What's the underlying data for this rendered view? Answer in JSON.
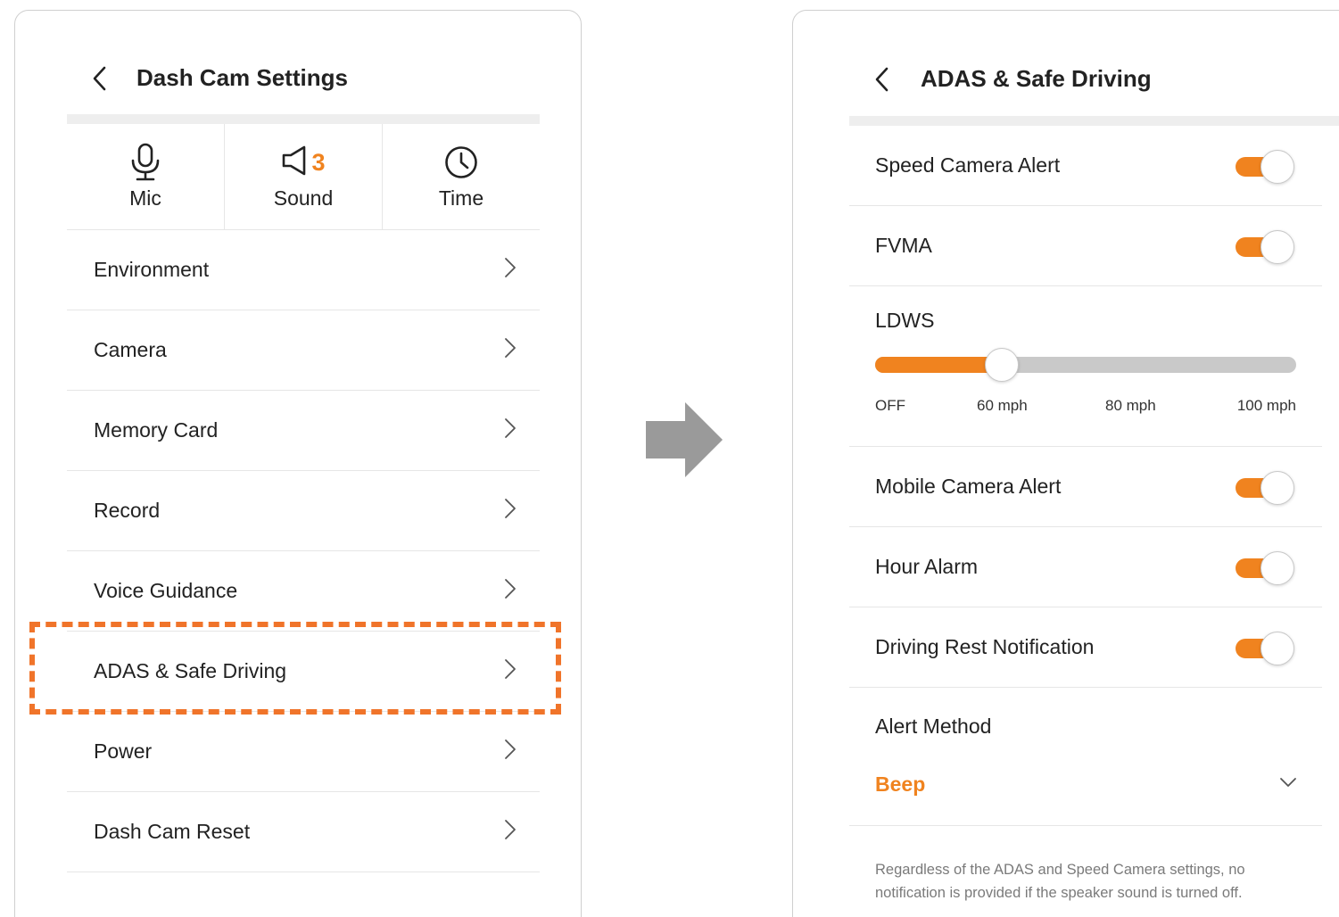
{
  "colors": {
    "accent": "#f0831f",
    "highlight": "#f0742a",
    "divider": "#e6e6e6",
    "arrow": "#9a9a9a"
  },
  "left": {
    "title": "Dash Cam Settings",
    "tiles": [
      {
        "label": "Mic",
        "icon": "microphone-icon"
      },
      {
        "label": "Sound",
        "icon": "speaker-icon",
        "level": "3"
      },
      {
        "label": "Time",
        "icon": "clock-icon"
      }
    ],
    "menu": [
      {
        "label": "Environment"
      },
      {
        "label": "Camera"
      },
      {
        "label": "Memory Card"
      },
      {
        "label": "Record"
      },
      {
        "label": "Voice Guidance"
      },
      {
        "label": "ADAS & Safe Driving",
        "highlighted": true
      },
      {
        "label": "Power"
      },
      {
        "label": "Dash Cam Reset"
      }
    ]
  },
  "transition_icon": "right-arrow-icon",
  "right": {
    "title": "ADAS & Safe Driving",
    "toggles_top": [
      {
        "label": "Speed Camera Alert",
        "on": true
      },
      {
        "label": "FVMA",
        "on": true
      }
    ],
    "ldws": {
      "label": "LDWS",
      "ticks": [
        "OFF",
        "60 mph",
        "80 mph",
        "100 mph"
      ],
      "value": "60 mph",
      "fraction": 0.3
    },
    "toggles_bottom": [
      {
        "label": "Mobile Camera Alert",
        "on": true
      },
      {
        "label": "Hour Alarm",
        "on": true
      },
      {
        "label": "Driving Rest Notification",
        "on": true
      }
    ],
    "alert_method": {
      "label": "Alert Method",
      "value": "Beep"
    },
    "note": "Regardless of the ADAS and Speed Camera settings, no notification is provided if the speaker sound is turned off."
  }
}
